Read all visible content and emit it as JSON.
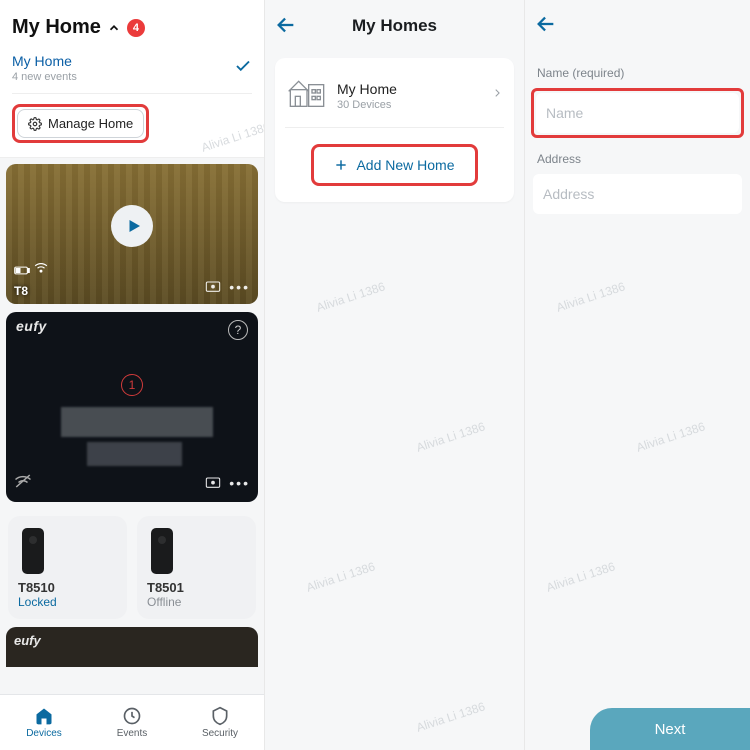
{
  "watermark": "Alivia Li 1386",
  "col1": {
    "title": "My Home",
    "badge": "4",
    "selected_home": "My Home",
    "selected_sub": "4 new events",
    "manage_label": "Manage Home",
    "cam1_label": "T8",
    "cam2_brand": "eufy",
    "cam2_alert": "1",
    "tile1_name": "T8510",
    "tile1_status": "Locked",
    "tile2_name": "T8501",
    "tile2_status": "Offline",
    "cam3_brand": "eufy",
    "tabs": {
      "devices": "Devices",
      "events": "Events",
      "security": "Security"
    }
  },
  "col2": {
    "title": "My Homes",
    "item_name": "My Home",
    "item_sub": "30 Devices",
    "add_label": "Add New Home"
  },
  "col3": {
    "name_label": "Name (required)",
    "name_placeholder": "Name",
    "address_label": "Address",
    "address_placeholder": "Address",
    "next": "Next"
  }
}
